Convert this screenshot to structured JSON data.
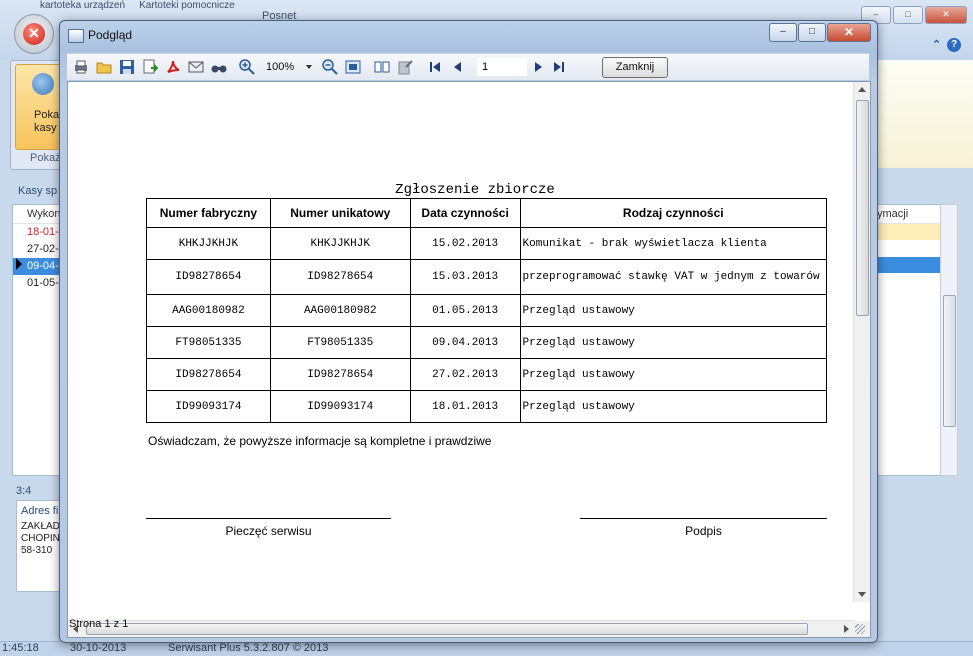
{
  "background": {
    "tabs": [
      "kartoteka urządzeń",
      "Kartoteki pomocnicze"
    ],
    "title": "Posnet",
    "ribbon_button": [
      "Poka",
      "kasy"
    ],
    "ribbon_group": "Pokaż",
    "section_label": "Kasy sp",
    "list_header": "Wykon",
    "list_rows": [
      "18-01-",
      "27-02-",
      "09-04-",
      "01-05-"
    ],
    "right_list_header": "ymacji",
    "count": "3:4",
    "address": {
      "header": "Adres fi",
      "lines": [
        "ZAKŁAD",
        "CHOPIN",
        "58-310"
      ]
    },
    "status": {
      "time": "1:45:18",
      "date": "30-10-2013",
      "product": "Serwisant Plus 5.3.2.807 © 2013"
    }
  },
  "dialog": {
    "title": "Podgląd",
    "toolbar": {
      "zoom": "100%",
      "page": "1",
      "close_label": "Zamknij"
    },
    "status": "Strona 1 z 1"
  },
  "document": {
    "title": "Zgłoszenie zbiorcze",
    "columns": [
      "Numer fabryczny",
      "Numer unikatowy",
      "Data czynności",
      "Rodzaj czynności"
    ],
    "rows": [
      [
        "KHKJJKHJK",
        "KHKJJKHJK",
        "15.02.2013",
        "Komunikat - brak wyświetlacza klienta"
      ],
      [
        "ID98278654",
        "ID98278654",
        "15.03.2013",
        "przeprogramować stawkę VAT w jednym z towarów"
      ],
      [
        "AAG00180982",
        "AAG00180982",
        "01.05.2013",
        "Przegląd ustawowy"
      ],
      [
        "FT98051335",
        "FT98051335",
        "09.04.2013",
        "Przegląd ustawowy"
      ],
      [
        "ID98278654",
        "ID98278654",
        "27.02.2013",
        "Przegląd ustawowy"
      ],
      [
        "ID99093174",
        "ID99093174",
        "18.01.2013",
        "Przegląd ustawowy"
      ]
    ],
    "declaration": "Oświadczam, że powyższe informacje są kompletne i prawdziwe",
    "stamp_label": "Pieczęć serwisu",
    "signature_label": "Podpis"
  }
}
